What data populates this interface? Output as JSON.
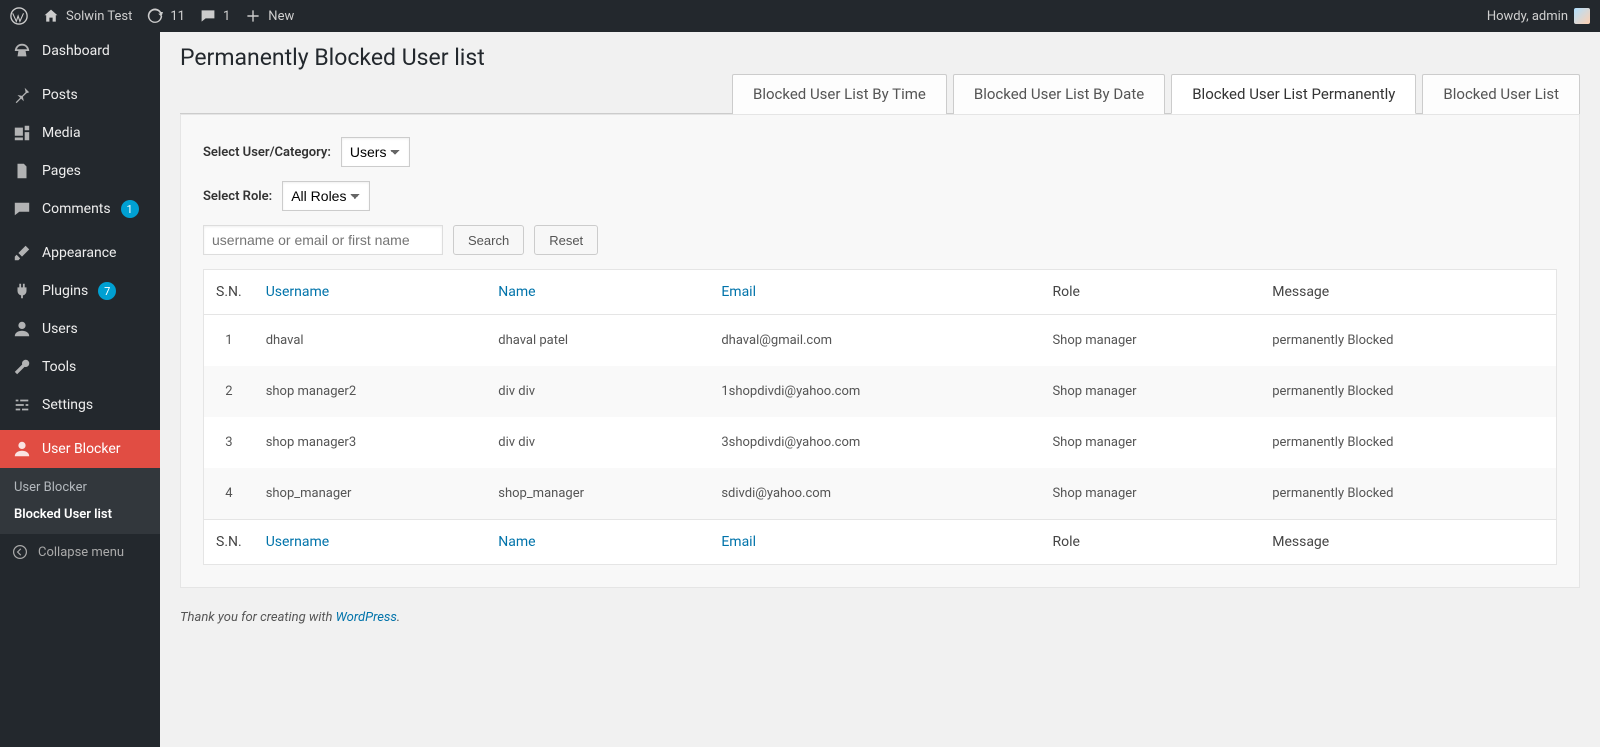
{
  "topbar": {
    "site_name": "Solwin Test",
    "updates_count": "11",
    "comments_count": "1",
    "new_label": "New",
    "howdy": "Howdy, admin"
  },
  "sidebar": {
    "dashboard": "Dashboard",
    "posts": "Posts",
    "media": "Media",
    "pages": "Pages",
    "comments": "Comments",
    "comments_badge": "1",
    "appearance": "Appearance",
    "plugins": "Plugins",
    "plugins_badge": "7",
    "users": "Users",
    "tools": "Tools",
    "settings": "Settings",
    "user_blocker": "User Blocker",
    "sub_user_blocker": "User Blocker",
    "sub_blocked_list": "Blocked User list",
    "collapse": "Collapse menu"
  },
  "page": {
    "title": "Permanently Blocked User list"
  },
  "tabs": [
    {
      "label": "Blocked User List By Time",
      "active": false
    },
    {
      "label": "Blocked User List By Date",
      "active": false
    },
    {
      "label": "Blocked User List Permanently",
      "active": true
    },
    {
      "label": "Blocked User List",
      "active": false
    }
  ],
  "filters": {
    "select_user_category_label": "Select User/Category:",
    "select_user_category_value": "Users",
    "select_role_label": "Select Role:",
    "select_role_value": "All Roles",
    "search_placeholder": "username or email or first name",
    "search_btn": "Search",
    "reset_btn": "Reset"
  },
  "table": {
    "headers": {
      "sn": "S.N.",
      "username": "Username",
      "name": "Name",
      "email": "Email",
      "role": "Role",
      "message": "Message"
    },
    "rows": [
      {
        "sn": "1",
        "username": "dhaval",
        "name": "dhaval patel",
        "email": "dhaval@gmail.com",
        "role": "Shop manager",
        "message": "permanently Blocked"
      },
      {
        "sn": "2",
        "username": "shop manager2",
        "name": "div div",
        "email": "1shopdivdi@yahoo.com",
        "role": "Shop manager",
        "message": "permanently Blocked"
      },
      {
        "sn": "3",
        "username": "shop manager3",
        "name": "div div",
        "email": "3shopdivdi@yahoo.com",
        "role": "Shop manager",
        "message": "permanently Blocked"
      },
      {
        "sn": "4",
        "username": "shop_manager",
        "name": "shop_manager",
        "email": "sdivdi@yahoo.com",
        "role": "Shop manager",
        "message": "permanently Blocked"
      }
    ]
  },
  "footer": {
    "prefix": "Thank you for creating with ",
    "link": "WordPress",
    "suffix": "."
  }
}
